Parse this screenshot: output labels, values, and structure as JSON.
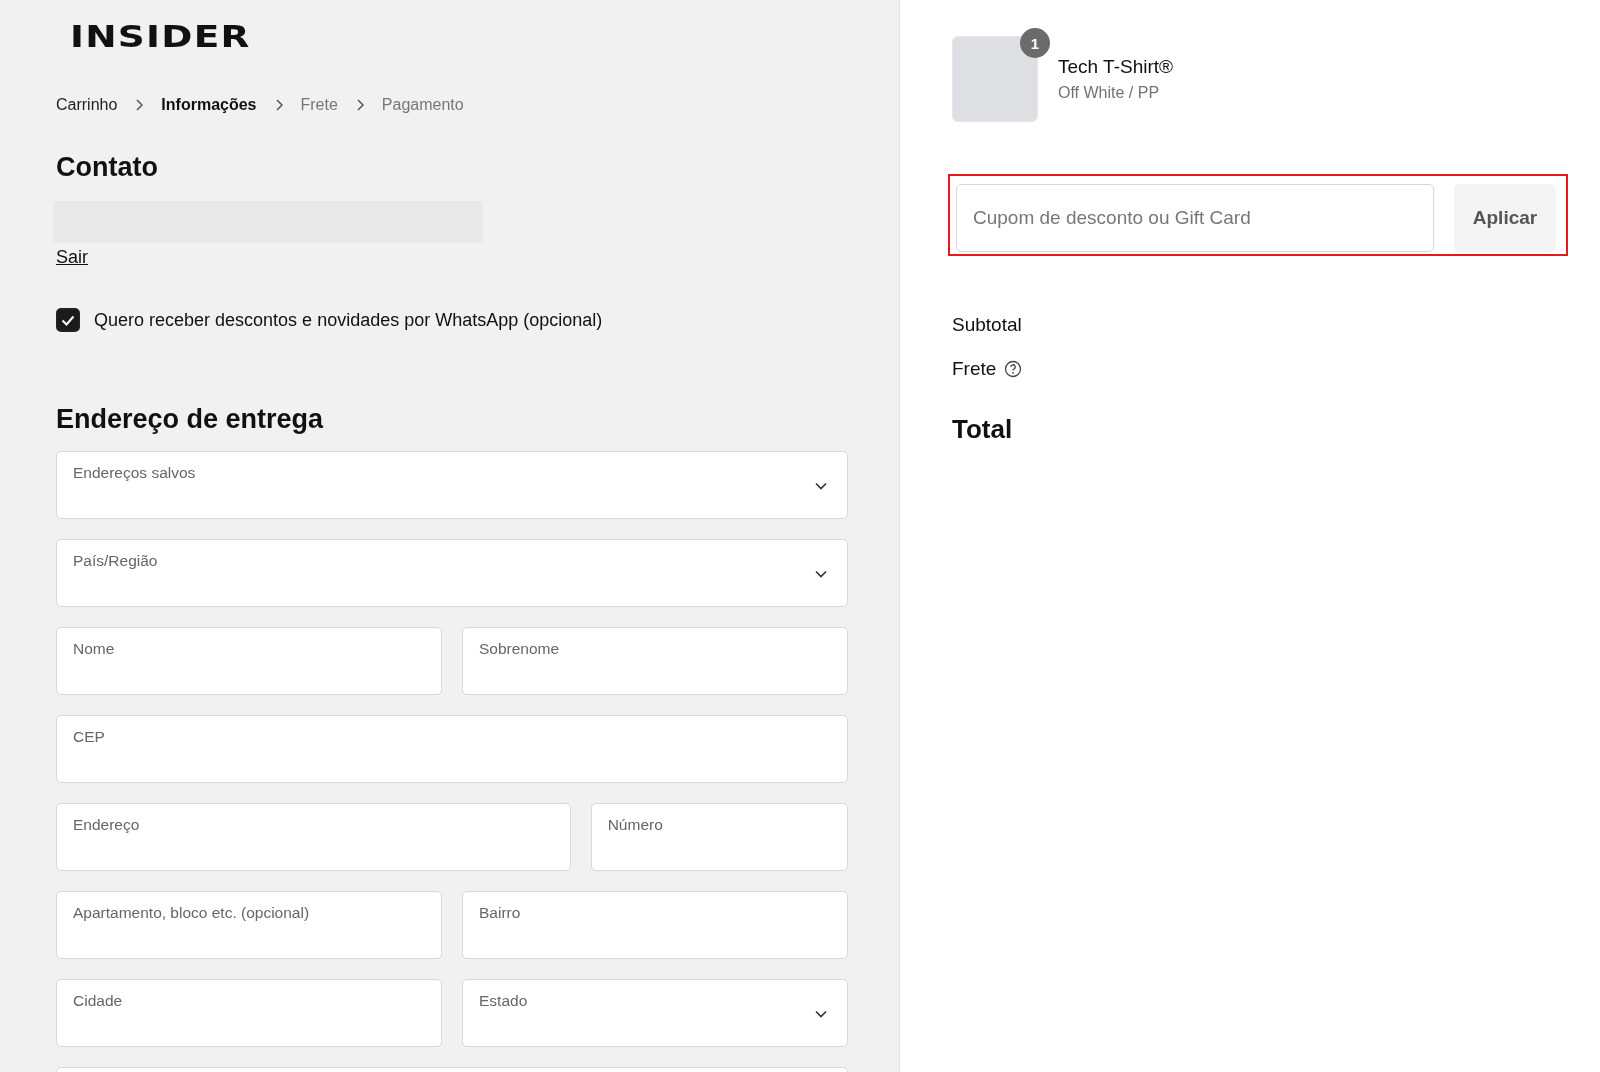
{
  "logo": "INSIDER",
  "breadcrumb": [
    {
      "label": "Carrinho",
      "selected": false
    },
    {
      "label": "Informações",
      "selected": true
    },
    {
      "label": "Frete",
      "selected": false
    },
    {
      "label": "Pagamento",
      "selected": false
    }
  ],
  "contact": {
    "heading": "Contato",
    "logout": "Sair",
    "whatsapp_optin": {
      "label": "Quero receber descontos e novidades por WhatsApp (opcional)",
      "checked": true
    }
  },
  "address": {
    "heading": "Endereço de entrega",
    "rows": [
      {
        "fields": [
          {
            "label": "Endereços salvos",
            "kind": "select"
          }
        ]
      },
      {
        "fields": [
          {
            "label": "País/Região",
            "kind": "select"
          }
        ]
      },
      {
        "fields": [
          {
            "label": "Nome",
            "kind": "text"
          },
          {
            "label": "Sobrenome",
            "kind": "text"
          }
        ]
      },
      {
        "fields": [
          {
            "label": "CEP",
            "kind": "text"
          }
        ]
      },
      {
        "fields": [
          {
            "label": "Endereço",
            "kind": "text",
            "wide": true
          },
          {
            "label": "Número",
            "kind": "text"
          }
        ]
      },
      {
        "fields": [
          {
            "label": "Apartamento, bloco etc. (opcional)",
            "kind": "text"
          },
          {
            "label": "Bairro",
            "kind": "text"
          }
        ]
      },
      {
        "fields": [
          {
            "label": "Cidade",
            "kind": "text"
          },
          {
            "label": "Estado",
            "kind": "select"
          }
        ]
      },
      {
        "fields": [
          {
            "kind": "text"
          }
        ]
      }
    ]
  },
  "cart": {
    "items": [
      {
        "name": "Tech T-Shirt®",
        "variant": "Off White / PP",
        "quantity": "1"
      }
    ],
    "coupon": {
      "placeholder": "Cupom de desconto ou Gift Card",
      "button": "Aplicar",
      "highlighted": true
    },
    "summary": [
      {
        "label": "Subtotal",
        "kind": "line",
        "help": false
      },
      {
        "label": "Frete",
        "kind": "line",
        "help": true
      },
      {
        "label": "Total",
        "kind": "total",
        "help": false
      }
    ]
  }
}
